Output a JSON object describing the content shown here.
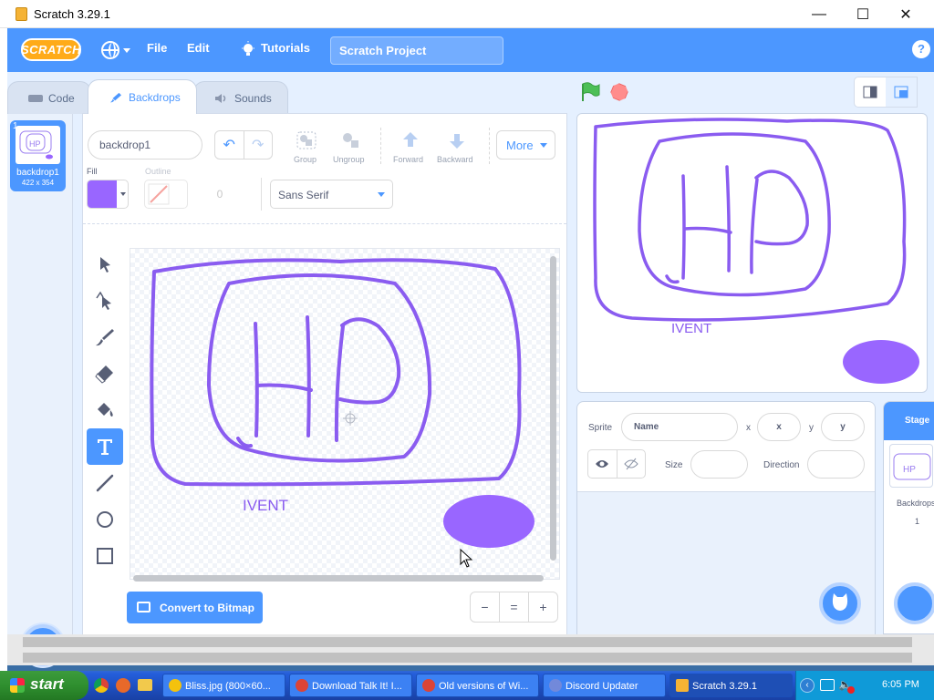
{
  "window": {
    "title": "Scratch 3.29.1",
    "minimize": "—",
    "maximize": "☐",
    "close": "✕"
  },
  "menubar": {
    "logo": "SCRATCH",
    "file": "File",
    "edit": "Edit",
    "tutorials": "Tutorials",
    "project_title": "Scratch Project",
    "help": "?"
  },
  "tabs": [
    {
      "label": "Code"
    },
    {
      "label": "Backdrops"
    },
    {
      "label": "Sounds"
    }
  ],
  "backdrop_list": [
    {
      "number": "1",
      "name": "backdrop1",
      "dims": "422 x 354"
    }
  ],
  "paint_editor": {
    "costume_name": "backdrop1",
    "group_label": "Group",
    "ungroup_label": "Ungroup",
    "forward_label": "Forward",
    "backward_label": "Backward",
    "more_label": "More",
    "fill_label": "Fill",
    "outline_label": "Outline",
    "outline_size": "0",
    "font": "Sans Serif",
    "fill_color": "#9966ff",
    "canvas_text": "IVENT",
    "convert_label": "Convert to Bitmap",
    "zoom_out": "−",
    "zoom_reset": "=",
    "zoom_in": "+"
  },
  "stage": {
    "text": "IVENT"
  },
  "sprite_info": {
    "sprite_label": "Sprite",
    "name_placeholder": "Name",
    "x_label": "x",
    "x_placeholder": "x",
    "y_label": "y",
    "y_placeholder": "y",
    "size_label": "Size",
    "direction_label": "Direction"
  },
  "stage_panel": {
    "header": "Stage",
    "backdrops_label": "Backdrops",
    "count": "1"
  },
  "taskbar": {
    "start": "start",
    "tasks": [
      {
        "label": "Bliss.jpg (800×60...",
        "color": "#f4c20d"
      },
      {
        "label": "Download Talk It! I...",
        "color": "#db4437"
      },
      {
        "label": "Old versions of Wi...",
        "color": "#db4437"
      },
      {
        "label": "Discord Updater",
        "color": "#7289da"
      },
      {
        "label": "Scratch 3.29.1",
        "color": "#f5b335"
      }
    ],
    "clock": "6:05 PM"
  },
  "colors": {
    "scratch_blue": "#4c97ff",
    "purple": "#9966ff",
    "stroke": "#8a5cf0"
  }
}
